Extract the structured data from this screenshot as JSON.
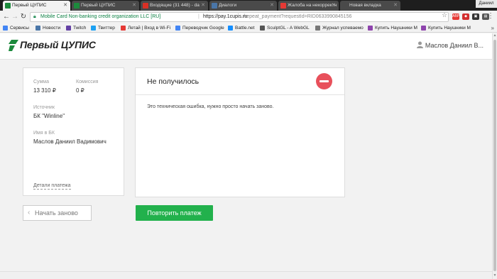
{
  "browser": {
    "tabs": [
      {
        "title": "Первый ЦУПИС",
        "icon_color": "#1c8a3c",
        "active": true
      },
      {
        "title": "Первый ЦУПИС",
        "icon_color": "#1c8a3c",
        "active": false
      },
      {
        "title": "Входящие (31 448) - da",
        "icon_color": "#d93025",
        "active": false
      },
      {
        "title": "Диалоги",
        "icon_color": "#4a76a8",
        "active": false
      },
      {
        "title": "Жалоба на некорректн",
        "icon_color": "#e53935",
        "active": false
      },
      {
        "title": "Новая вкладка",
        "icon_color": "#777777",
        "active": false
      }
    ],
    "profile_name": "Даниил",
    "address": {
      "org": "Mobile Card Non-banking credit organization LLC [RU]",
      "host": "https://pay.1cupis.ru",
      "path": "/repeat_payment?requestId=RID0633990845156"
    },
    "bookmarks": [
      {
        "label": "Сервисы",
        "icon_color": "#4285f4"
      },
      {
        "label": "Новости",
        "icon_color": "#4a76a8"
      },
      {
        "label": "Twitch",
        "icon_color": "#6441a5"
      },
      {
        "label": "Твиттер",
        "icon_color": "#1da1f2"
      },
      {
        "label": "Летай | Вход в Wi-Fi",
        "icon_color": "#e53935"
      },
      {
        "label": "Переводчик Google",
        "icon_color": "#4285f4"
      },
      {
        "label": "Battle.net",
        "icon_color": "#148eff"
      },
      {
        "label": "SculptGL - A WebGL",
        "icon_color": "#555555"
      },
      {
        "label": "Журнал успеваемо",
        "icon_color": "#777777"
      },
      {
        "label": "Купить Наушники M",
        "icon_color": "#8e44ad"
      },
      {
        "label": "Купить Наушники M",
        "icon_color": "#8e44ad"
      }
    ]
  },
  "site": {
    "logo_text": "Первый ЦУПИС",
    "user_name": "Маслов Даниил В..."
  },
  "payment": {
    "amount_label": "Сумма",
    "amount": "13 310 ₽",
    "fee_label": "Комиссия",
    "fee": "0 ₽",
    "source_label": "Источник",
    "source": "БК \"Winline\"",
    "name_label": "Имя в БК",
    "name": "Маслов Даниил Вадимович",
    "details_link": "Детали платежа"
  },
  "error": {
    "title": "Не получилось",
    "message": "Это техническая ошибка, нужно просто начать заново."
  },
  "actions": {
    "restart": "Начать заново",
    "retry": "Повторить платеж"
  },
  "colors": {
    "brand_green": "#22b14c",
    "error_red": "#e8505b"
  }
}
